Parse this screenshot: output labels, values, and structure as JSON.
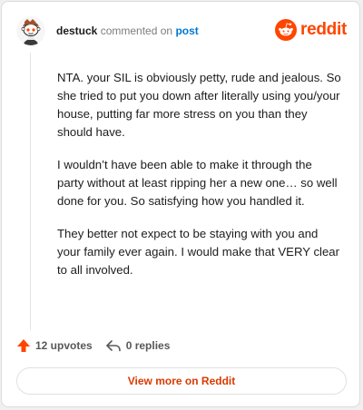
{
  "comment": {
    "username": "destuck",
    "action_text": "commented on",
    "post_link": "post",
    "avatar_icon": "snoo-avatar-icon",
    "paragraphs": [
      "NTA. your SIL is obviously petty, rude and jealous. So she tried to put you down after literally using you/your house, putting far more stress on you than they should have.",
      "I wouldn’t have been able to make it through the party without at least ripping her a new one… so well done for you. So satisfying how you handled it.",
      "They better not expect to be staying with you and your family ever again. I would make that VERY clear to all involved."
    ]
  },
  "brand": {
    "wordmark": "reddit",
    "logo_icon": "reddit-logo-icon",
    "color": "#ff4500"
  },
  "footer": {
    "upvotes_label": "12 upvotes",
    "upvote_icon": "upvote-arrow-icon",
    "replies_label": "0 replies",
    "reply_icon": "reply-arrow-icon",
    "upvote_color": "#ff4500"
  },
  "button": {
    "label": "View more on Reddit",
    "color": "#d93a00"
  }
}
